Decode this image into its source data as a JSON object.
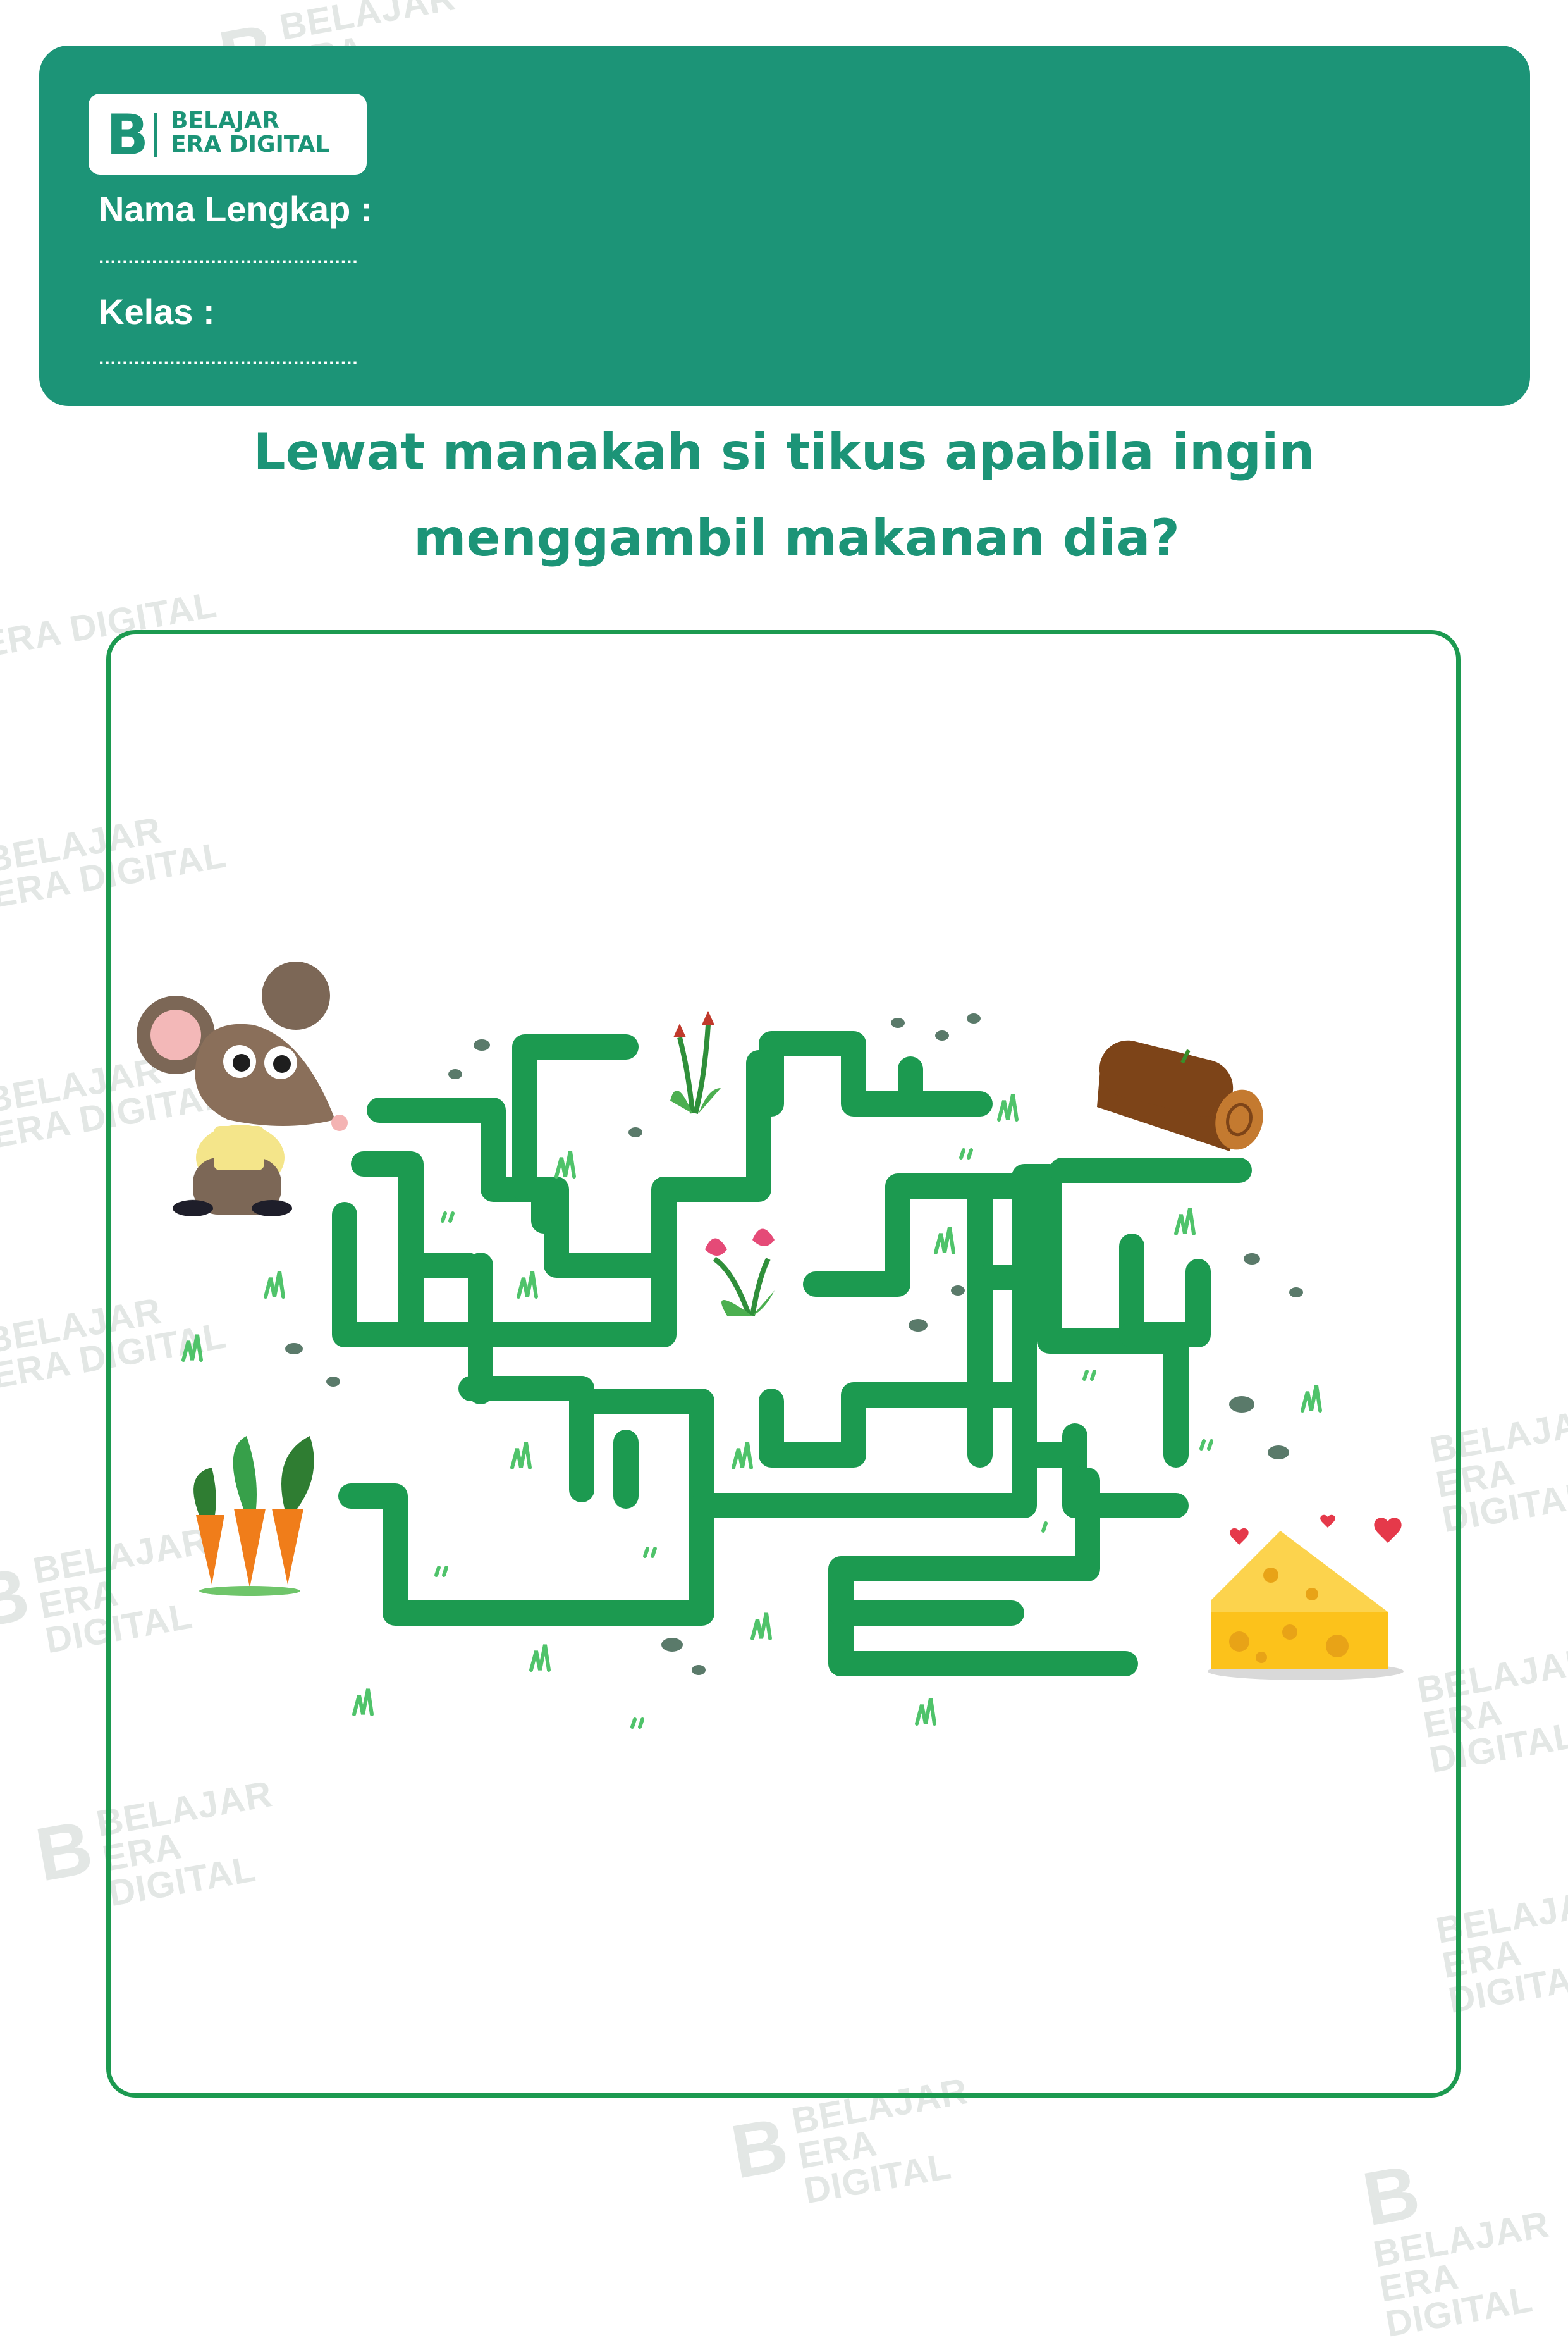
{
  "brand": {
    "mark": "B",
    "line1": "BELAJAR",
    "line2": "ERA DIGITAL"
  },
  "form": {
    "name_label": "Nama Lengkap :",
    "name_blank": "............................................",
    "class_label": "Kelas :",
    "class_blank": "............................................"
  },
  "question": {
    "line1": "Lewat manakah si tikus apabila ingin",
    "line2": "menggambil makanan dia?"
  },
  "colors": {
    "header": "#1c9477",
    "maze": "#1c9a50",
    "frame": "#1c9a50"
  }
}
